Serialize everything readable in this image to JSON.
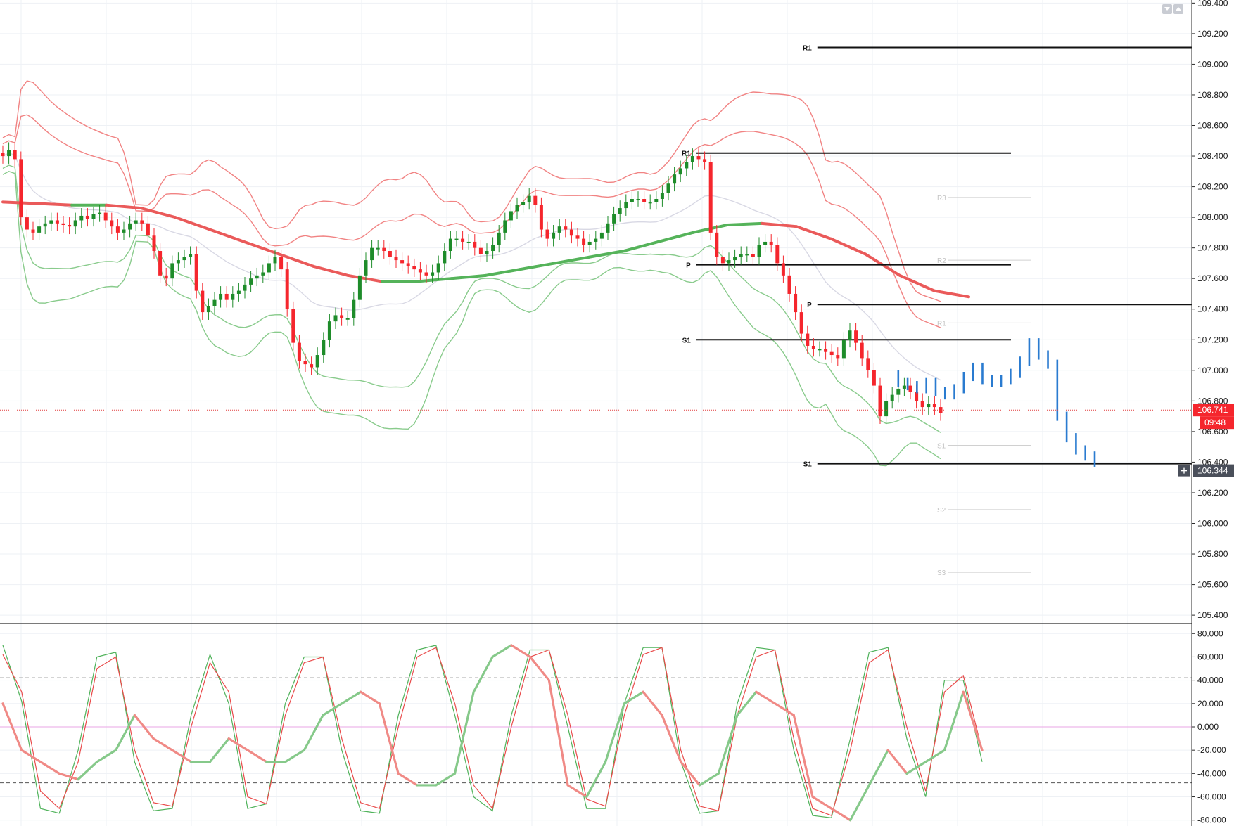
{
  "chart_data": {
    "type": "candlestick",
    "main_panel": {
      "price_axis_ticks": [
        "109.400",
        "109.200",
        "109.000",
        "108.800",
        "108.600",
        "108.400",
        "108.200",
        "108.000",
        "107.800",
        "107.600",
        "107.400",
        "107.200",
        "107.000",
        "106.800",
        "106.600",
        "106.400",
        "106.200",
        "106.000",
        "105.800",
        "105.600",
        "105.400"
      ],
      "ylim": [
        105.35,
        109.42
      ],
      "last_price": "106.741",
      "countdown": "09:48",
      "crosshair_price": "106.344",
      "colors": {
        "up": "#1e8c2a",
        "down": "#f5262d",
        "forecast": "#2a7bd0",
        "bb_upper": "#ef7575",
        "bb_lower": "#7cc57f",
        "ma_down": "#ea5a5a",
        "ma_up": "#55b35a"
      },
      "pivots": [
        {
          "label": "R1",
          "price": 109.11,
          "start": 133,
          "end": 240
        },
        {
          "label": "R1",
          "price": 108.42,
          "start": 113,
          "end": 240
        },
        {
          "label": "P",
          "price": 107.69,
          "start": 113,
          "end": 240
        },
        {
          "label": "P",
          "price": 107.43,
          "start": 133,
          "end": 240
        },
        {
          "label": "S1",
          "price": 107.2,
          "start": 113,
          "end": 240
        },
        {
          "label": "S1",
          "price": 106.39,
          "start": 133,
          "end": 240
        }
      ],
      "faint_pivots": [
        {
          "label": "R3",
          "price": 108.13
        },
        {
          "label": "R2",
          "price": 107.72
        },
        {
          "label": "R1",
          "price": 107.31
        },
        {
          "label": "S1",
          "price": 106.51
        },
        {
          "label": "S2",
          "price": 106.09
        },
        {
          "label": "S3",
          "price": 105.68
        }
      ],
      "close_series": [
        108.4,
        108.44,
        108.38,
        108.0,
        107.92,
        107.9,
        107.94,
        107.96,
        107.98,
        107.96,
        107.95,
        107.94,
        107.98,
        108.01,
        107.99,
        108.02,
        108.03,
        107.98,
        107.94,
        107.9,
        107.92,
        107.96,
        107.98,
        107.96,
        107.88,
        107.78,
        107.62,
        107.6,
        107.7,
        107.72,
        107.74,
        107.76,
        107.52,
        107.38,
        107.42,
        107.46,
        107.5,
        107.46,
        107.5,
        107.52,
        107.56,
        107.6,
        107.62,
        107.64,
        107.7,
        107.74,
        107.66,
        107.4,
        107.18,
        107.06,
        107.04,
        107.02,
        107.1,
        107.2,
        107.32,
        107.36,
        107.34,
        107.34,
        107.46,
        107.62,
        107.72,
        107.8,
        107.8,
        107.78,
        107.74,
        107.72,
        107.7,
        107.68,
        107.66,
        107.64,
        107.62,
        107.64,
        107.7,
        107.78,
        107.86,
        107.86,
        107.84,
        107.84,
        107.8,
        107.76,
        107.78,
        107.82,
        107.9,
        107.98,
        108.04,
        108.08,
        108.1,
        108.14,
        108.08,
        107.92,
        107.86,
        107.9,
        107.94,
        107.92,
        107.88,
        107.86,
        107.82,
        107.84,
        107.86,
        107.9,
        107.96,
        108.02,
        108.06,
        108.1,
        108.12,
        108.12,
        108.1,
        108.1,
        108.12,
        108.16,
        108.22,
        108.28,
        108.32,
        108.36,
        108.4,
        108.38,
        108.36,
        107.9,
        107.74,
        107.7,
        107.72,
        107.74,
        107.76,
        107.76,
        107.74,
        107.82,
        107.84,
        107.82,
        107.7,
        107.62,
        107.5,
        107.38,
        107.24,
        107.16,
        107.14,
        107.14,
        107.12,
        107.1,
        107.08,
        107.2,
        107.26,
        107.18,
        107.08,
        107.0,
        106.9,
        106.7,
        106.8,
        106.84,
        106.88,
        106.9,
        106.86,
        106.8,
        106.76,
        106.78,
        106.76,
        106.72
      ],
      "forecast_series": [
        106.92,
        106.9,
        106.88,
        106.92,
        106.86,
        106.84,
        106.88,
        106.96,
        107.02,
        106.94,
        106.92,
        106.94,
        106.98,
        107.06,
        107.18,
        107.1,
        107.04,
        106.7,
        106.56,
        106.48,
        106.44,
        106.4
      ],
      "ma_series": [
        108.1,
        108.09,
        108.08,
        108.08,
        108.06,
        108.0,
        107.92,
        107.84,
        107.76,
        107.68,
        107.62,
        107.58,
        107.58,
        107.6,
        107.62,
        107.66,
        107.7,
        107.74,
        107.78,
        107.84,
        107.9,
        107.95,
        107.96,
        107.94,
        107.86,
        107.76,
        107.62,
        107.52,
        107.48
      ]
    },
    "oscillator_panel": {
      "axis_ticks": [
        "80.000",
        "60.000",
        "40.000",
        "20.000",
        "0.000",
        "-20.000",
        "-40.000",
        "-60.000",
        "-80.000"
      ],
      "ylim": [
        -85,
        88
      ],
      "upper_band": 42,
      "lower_band": -48,
      "zero_line": 0,
      "fast_series": [
        70,
        22,
        -70,
        -74,
        -20,
        60,
        64,
        -30,
        -72,
        -70,
        10,
        62,
        20,
        -70,
        -66,
        20,
        60,
        60,
        -20,
        -72,
        -74,
        10,
        66,
        70,
        10,
        -60,
        -72,
        10,
        66,
        66,
        0,
        -70,
        -70,
        20,
        68,
        68,
        -30,
        -74,
        -72,
        20,
        68,
        66,
        -20,
        -76,
        -78,
        -10,
        64,
        68,
        -10,
        -60,
        40,
        40,
        -30
      ],
      "slow_series": [
        62,
        30,
        -55,
        -70,
        -30,
        50,
        60,
        -20,
        -65,
        -68,
        0,
        55,
        30,
        -60,
        -66,
        10,
        55,
        60,
        -10,
        -65,
        -70,
        0,
        60,
        68,
        20,
        -50,
        -70,
        0,
        60,
        66,
        10,
        -62,
        -68,
        10,
        62,
        68,
        -20,
        -68,
        -72,
        10,
        60,
        66,
        -10,
        -70,
        -76,
        -20,
        55,
        66,
        0,
        -55,
        30,
        44,
        -20
      ],
      "signal_series": [
        20,
        -20,
        -30,
        -40,
        -45,
        -30,
        -20,
        10,
        -10,
        -20,
        -30,
        -30,
        -10,
        -20,
        -30,
        -30,
        -20,
        10,
        20,
        30,
        20,
        -40,
        -50,
        -50,
        -40,
        30,
        60,
        70,
        60,
        40,
        -50,
        -60,
        -30,
        20,
        30,
        10,
        -30,
        -50,
        -40,
        10,
        30,
        20,
        10,
        -60,
        -70,
        -80,
        -50,
        -20,
        -40,
        -30,
        -20,
        30,
        -20
      ]
    }
  }
}
